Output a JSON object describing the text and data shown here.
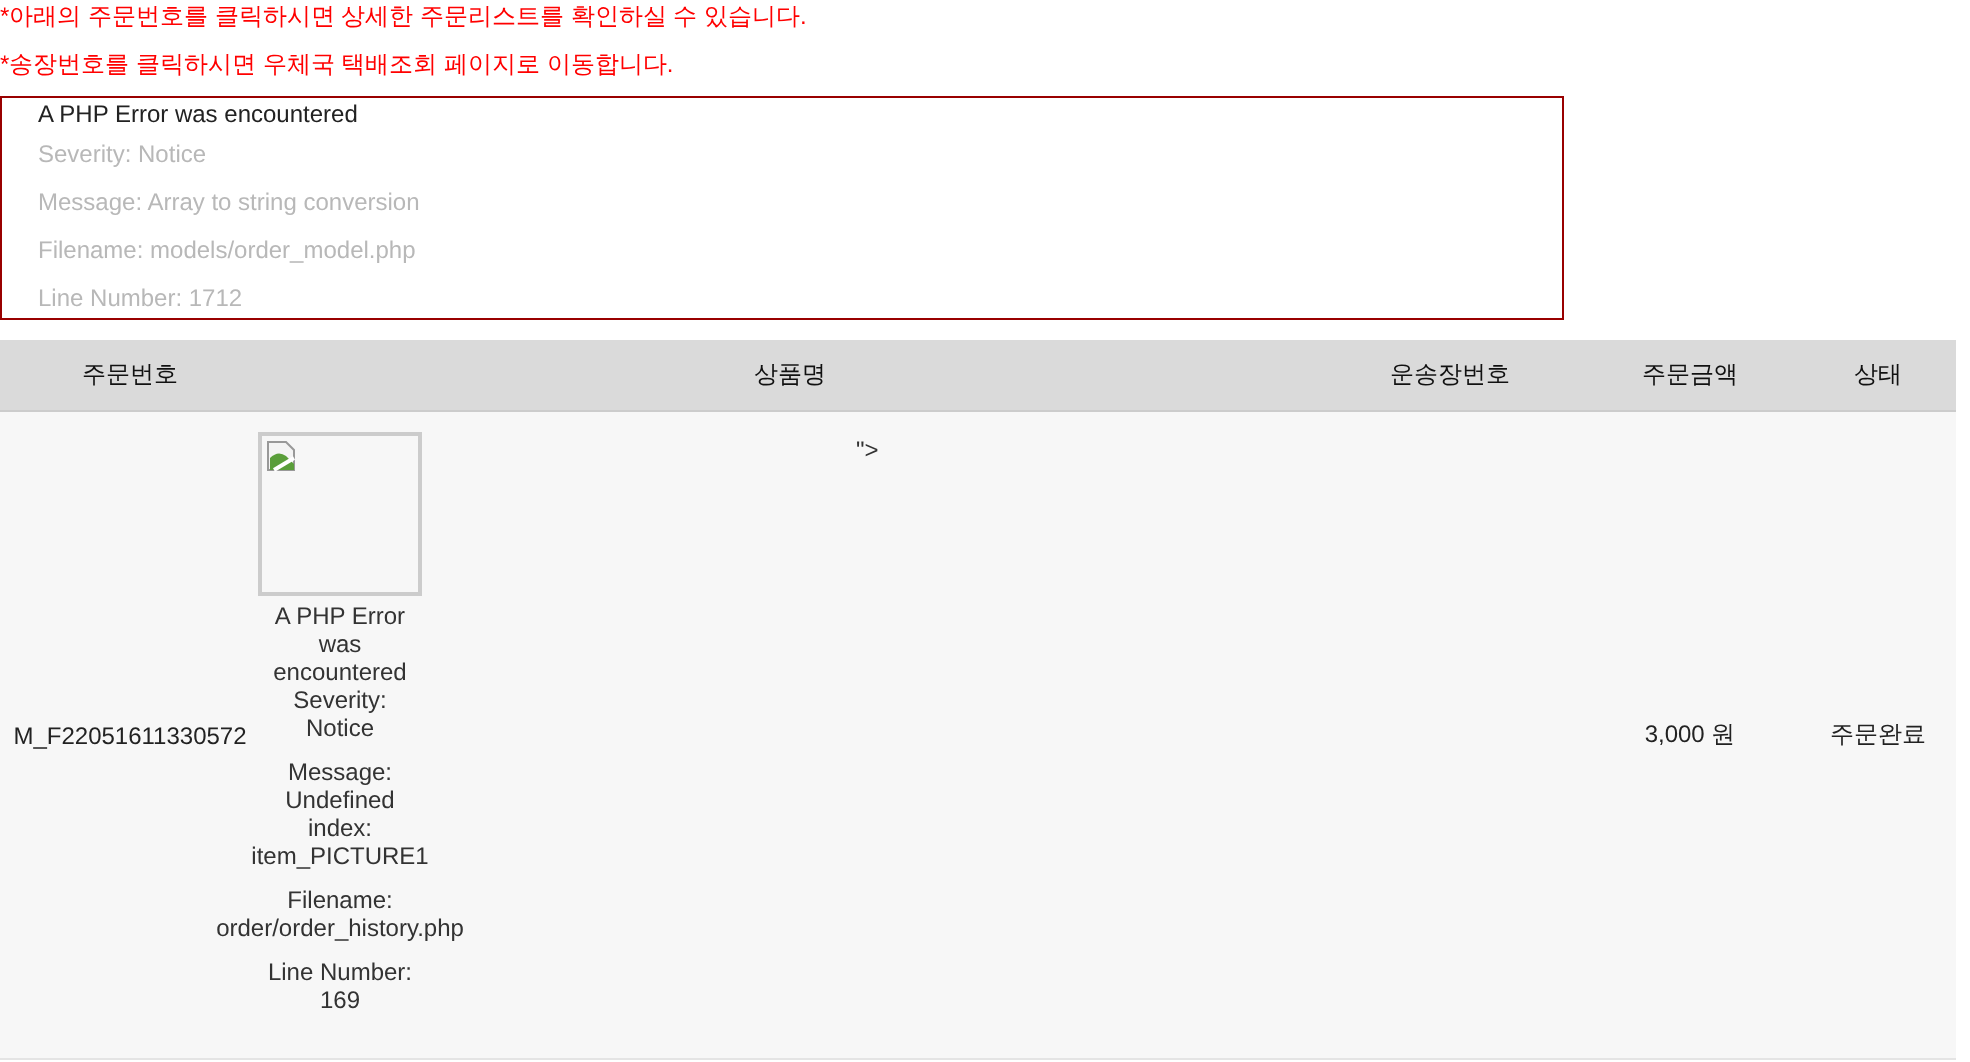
{
  "notices": [
    "*아래의 주문번호를 클릭하시면 상세한 주문리스트를 확인하실 수 있습니다.",
    "*송장번호를 클릭하시면 우체국 택배조회 페이지로 이동합니다."
  ],
  "error_box": {
    "title": "A PHP Error was encountered",
    "lines": [
      "Severity: Notice",
      "Message: Array to string conversion",
      "Filename: models/order_model.php",
      "Line Number: 1712"
    ]
  },
  "table": {
    "columns": [
      "주문번호",
      "상품명",
      "운송장번호",
      "주문금액",
      "상태"
    ],
    "rows": [
      {
        "order_number": "M_F22051611330572",
        "product": {
          "error": {
            "title": "A PHP Error was encountered",
            "severity": "Severity: Notice",
            "lines": [
              "Message: Undefined index: item_PICTURE1",
              "Filename: order/order_history.php",
              "Line Number: 169"
            ]
          },
          "name": "\">"
        },
        "amount": "3,000 원",
        "status": "주문완료"
      }
    ]
  }
}
